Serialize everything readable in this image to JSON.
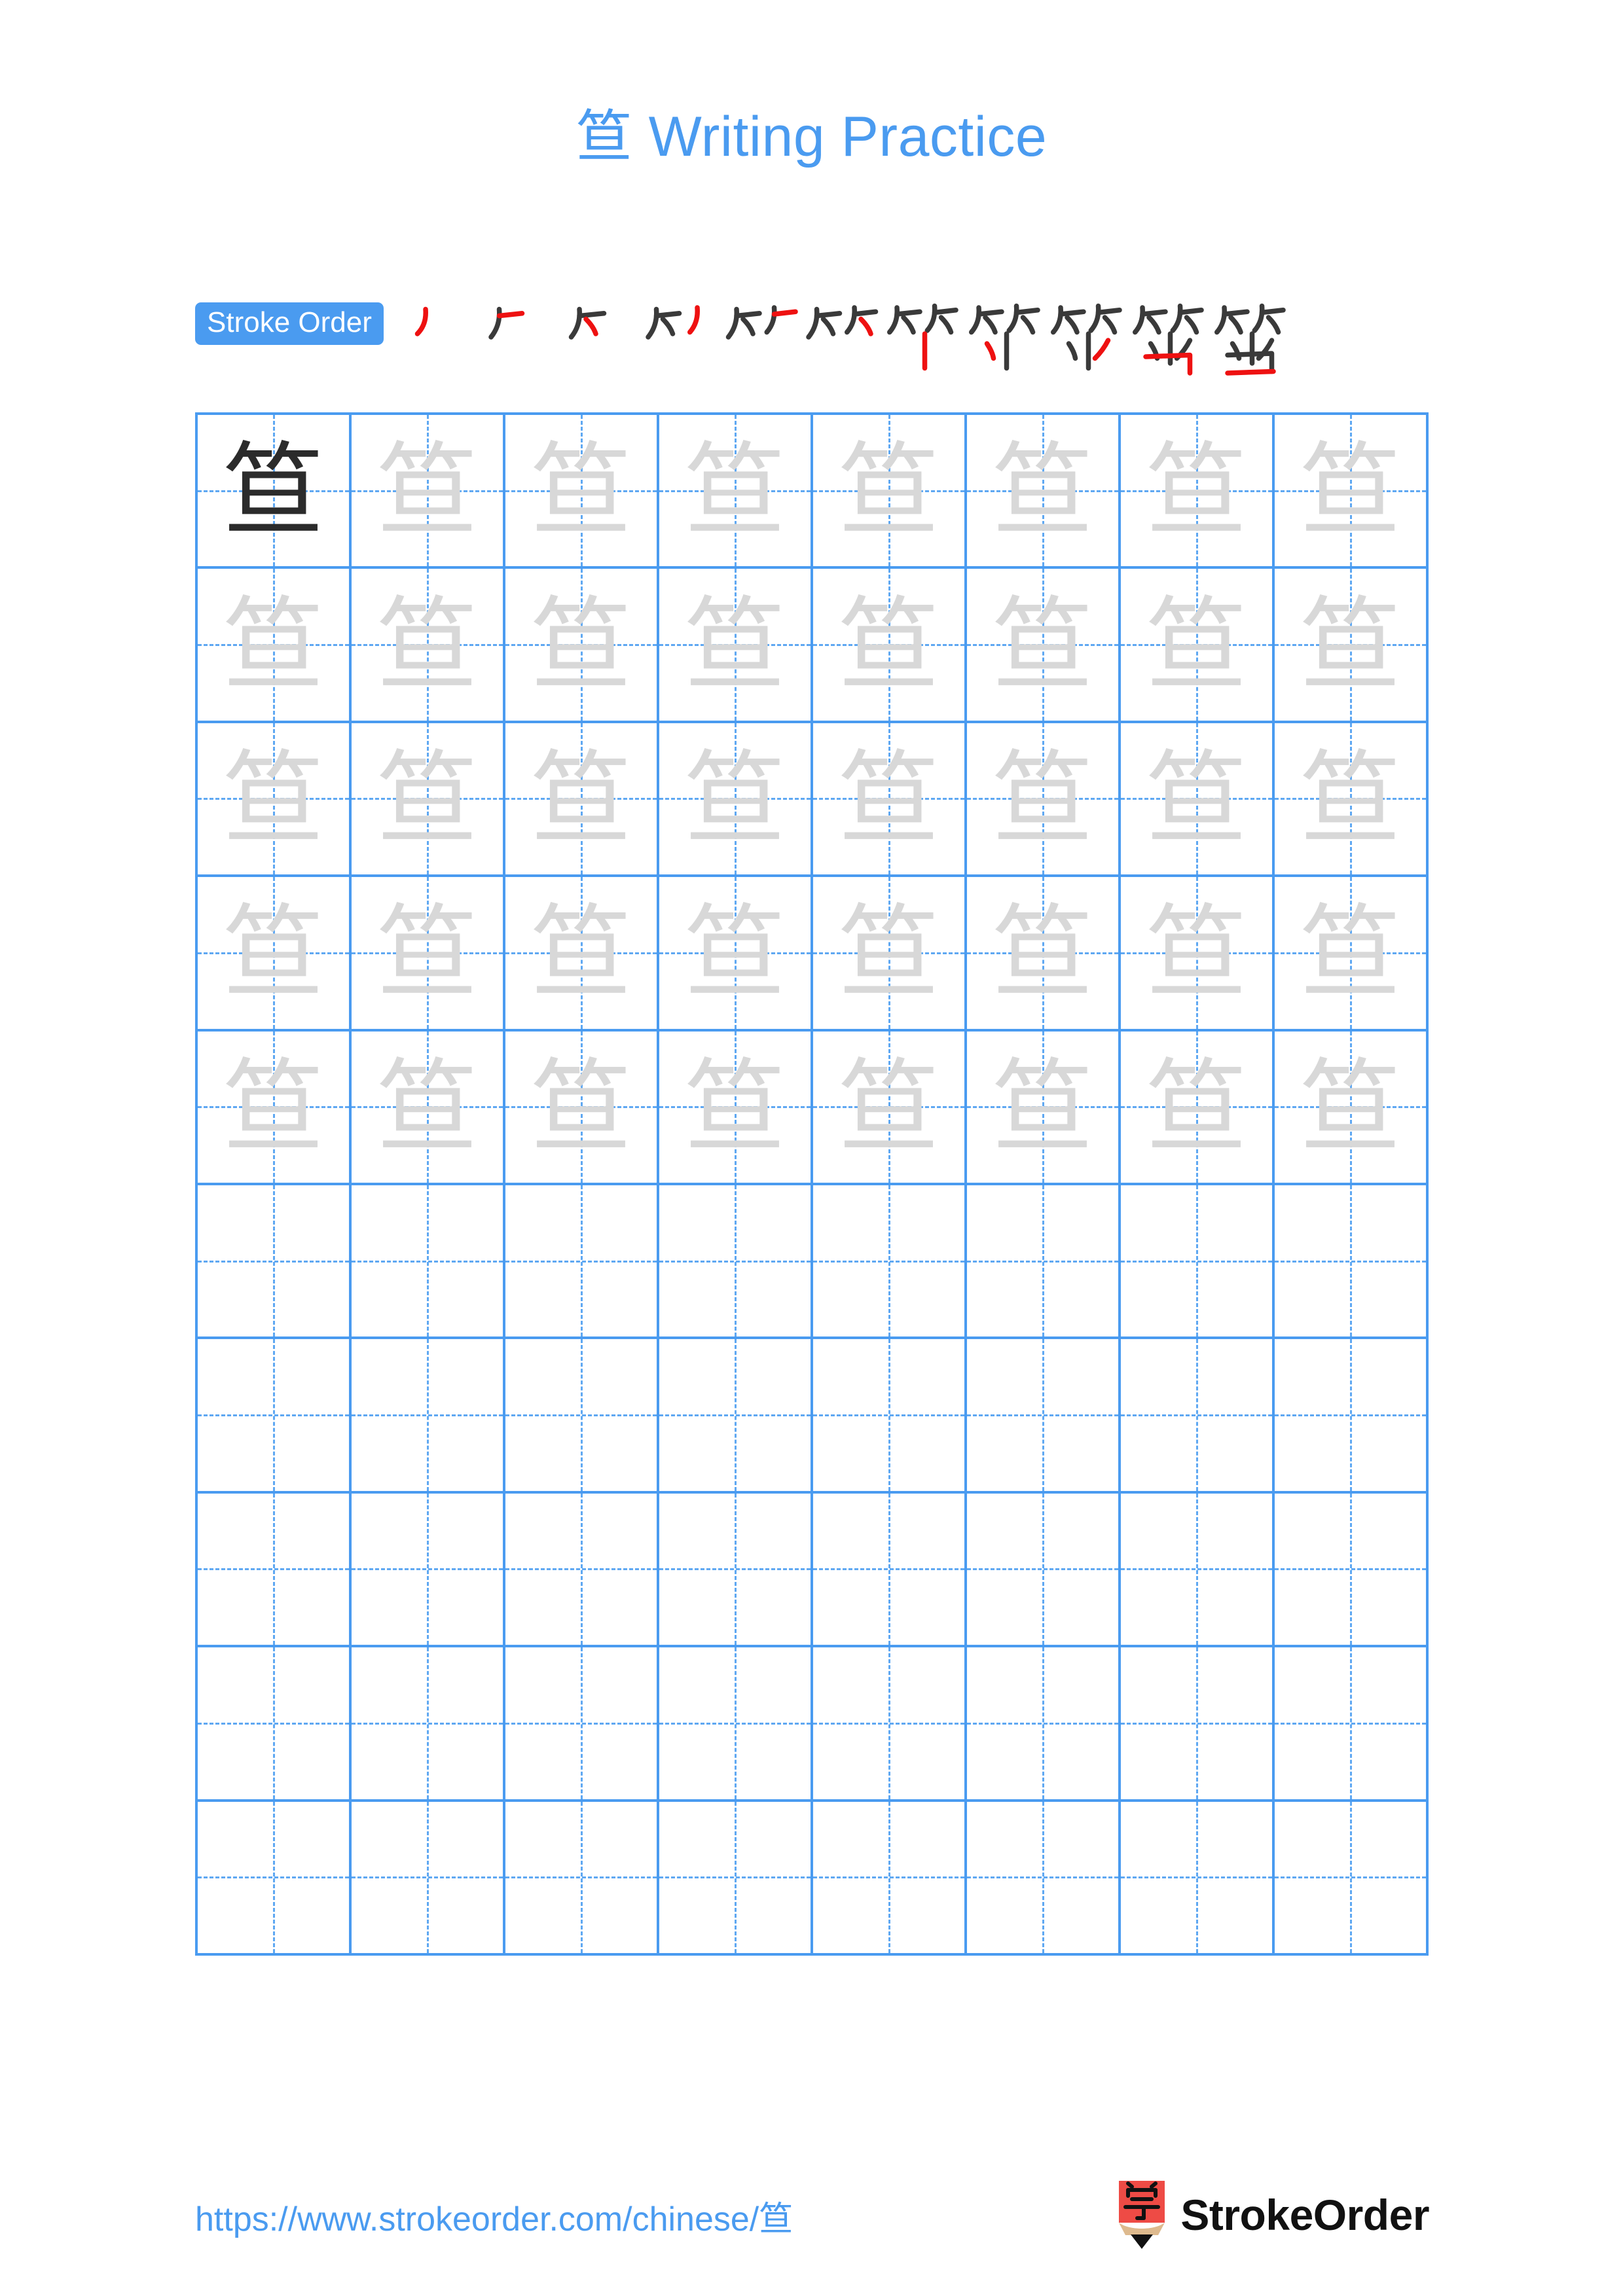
{
  "page": {
    "background_color": "#ffffff",
    "accent_blue": "#4a9bf0",
    "grid_line_color": "#4a9bf0",
    "guide_line_color": "#5fa8f2",
    "dark_char_color": "#2b2b2b",
    "light_char_color": "#d8d8d8",
    "stroke_highlight_color": "#ee1111",
    "stroke_ink_color": "#3a3a3a"
  },
  "title": {
    "character": "笪",
    "text": "Writing Practice",
    "full": "笪 Writing Practice"
  },
  "stroke_order": {
    "badge_label": "Stroke Order",
    "character": "笪",
    "stroke_count": 11,
    "steps": [
      {
        "index": 1,
        "partial": "丿"
      },
      {
        "index": 2,
        "partial": "𠂉"
      },
      {
        "index": 3,
        "partial": "𠂉"
      },
      {
        "index": 4,
        "partial": "⺮"
      },
      {
        "index": 5,
        "partial": "⺮"
      },
      {
        "index": 6,
        "partial": "⺮"
      },
      {
        "index": 7,
        "partial": "竹"
      },
      {
        "index": 8,
        "partial": "竺"
      },
      {
        "index": 9,
        "partial": "笁"
      },
      {
        "index": 10,
        "partial": "笪"
      },
      {
        "index": 11,
        "partial": "笪"
      }
    ]
  },
  "grid": {
    "rows": 10,
    "columns": 8,
    "total_cells": 80,
    "filled_rows": 5,
    "empty_rows": 5,
    "character": "笪",
    "cells": [
      [
        "dark",
        "light",
        "light",
        "light",
        "light",
        "light",
        "light",
        "light"
      ],
      [
        "light",
        "light",
        "light",
        "light",
        "light",
        "light",
        "light",
        "light"
      ],
      [
        "light",
        "light",
        "light",
        "light",
        "light",
        "light",
        "light",
        "light"
      ],
      [
        "light",
        "light",
        "light",
        "light",
        "light",
        "light",
        "light",
        "light"
      ],
      [
        "light",
        "light",
        "light",
        "light",
        "light",
        "light",
        "light",
        "light"
      ],
      [
        "empty",
        "empty",
        "empty",
        "empty",
        "empty",
        "empty",
        "empty",
        "empty"
      ],
      [
        "empty",
        "empty",
        "empty",
        "empty",
        "empty",
        "empty",
        "empty",
        "empty"
      ],
      [
        "empty",
        "empty",
        "empty",
        "empty",
        "empty",
        "empty",
        "empty",
        "empty"
      ],
      [
        "empty",
        "empty",
        "empty",
        "empty",
        "empty",
        "empty",
        "empty",
        "empty"
      ],
      [
        "empty",
        "empty",
        "empty",
        "empty",
        "empty",
        "empty",
        "empty",
        "empty"
      ]
    ]
  },
  "footer": {
    "url": "https://www.strokeorder.com/chinese/笪",
    "brand_name": "StrokeOrder",
    "logo": {
      "icon_name": "pencil-logo-icon",
      "body_color": "#ee4b45",
      "wood_color": "#deba8e",
      "tip_color": "#111111",
      "glyph": "字"
    }
  }
}
